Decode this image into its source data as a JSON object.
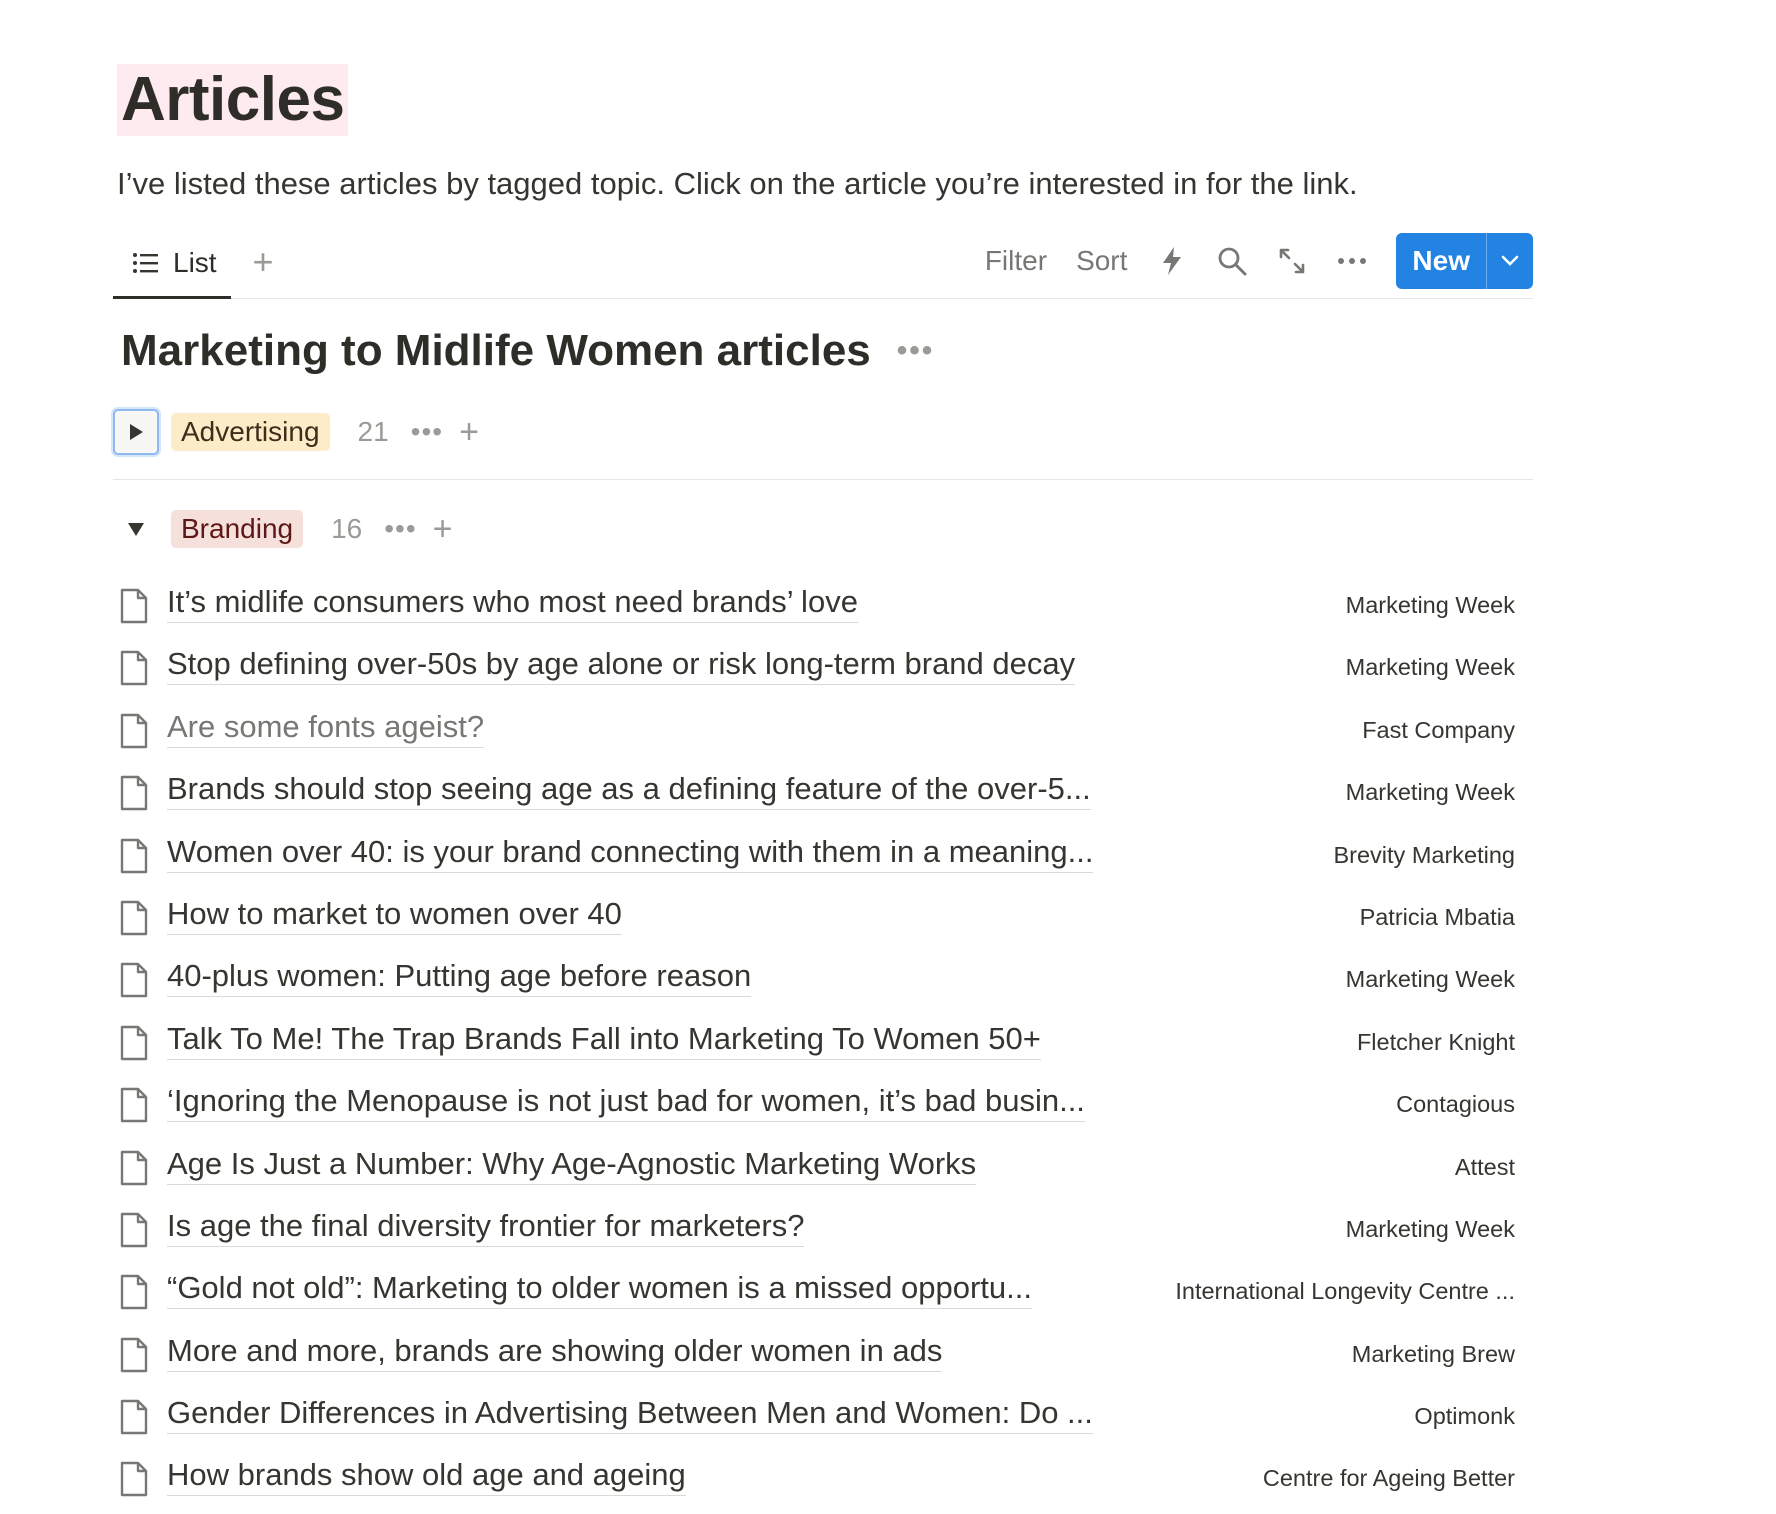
{
  "page": {
    "title": "Articles",
    "description": "I’ve listed these articles by tagged topic. Click on the article you’re interested in for the link."
  },
  "viewbar": {
    "tab_label": "List",
    "filter_label": "Filter",
    "sort_label": "Sort",
    "new_label": "New"
  },
  "database": {
    "title": "Marketing to Midlife Women articles",
    "more": "•••"
  },
  "groups": [
    {
      "tag": "Advertising",
      "count": "21",
      "collapsed": true,
      "color": "#fdecc8"
    },
    {
      "tag": "Branding",
      "count": "16",
      "collapsed": false,
      "color": "#f5e0dc"
    }
  ],
  "colors": {
    "accent": "#2383e2",
    "text": "#37352f",
    "muted": "#9b9a97"
  },
  "articles": [
    {
      "title": "It’s midlife consumers who most need brands’ love",
      "source": "Marketing Week",
      "muted": false
    },
    {
      "title": "Stop defining over-50s by age alone or risk long-term brand decay",
      "source": "Marketing Week",
      "muted": false
    },
    {
      "title": "Are some fonts ageist?",
      "source": "Fast Company",
      "muted": true
    },
    {
      "title": "Brands should stop seeing age as a defining feature of the over-5...",
      "source": "Marketing Week",
      "muted": false
    },
    {
      "title": "Women over 40: is your brand connecting with them in a meaning...",
      "source": "Brevity Marketing",
      "muted": false
    },
    {
      "title": "How to market to women over 40",
      "source": "Patricia Mbatia",
      "muted": false
    },
    {
      "title": "40-plus women: Putting age before reason",
      "source": "Marketing Week",
      "muted": false
    },
    {
      "title": "Talk To Me! The Trap Brands Fall into Marketing To Women 50+",
      "source": "Fletcher Knight",
      "muted": false
    },
    {
      "title": "‘Ignoring the Menopause is not just bad for women, it’s bad busin...",
      "source": "Contagious",
      "muted": false
    },
    {
      "title": "Age Is Just a Number: Why Age-Agnostic Marketing Works",
      "source": "Attest",
      "muted": false
    },
    {
      "title": "Is age the final diversity frontier for marketers?",
      "source": "Marketing Week",
      "muted": false
    },
    {
      "title": "“Gold not old”: Marketing to older women is a missed opportu...",
      "source": "International Longevity Centre ...",
      "muted": false
    },
    {
      "title": "More and more, brands are showing older women in ads",
      "source": "Marketing Brew",
      "muted": false
    },
    {
      "title": "Gender Differences in Advertising Between Men and Women: Do ...",
      "source": "Optimonk",
      "muted": false
    },
    {
      "title": "How brands show old age and ageing",
      "source": "Centre for Ageing Better",
      "muted": false
    }
  ]
}
